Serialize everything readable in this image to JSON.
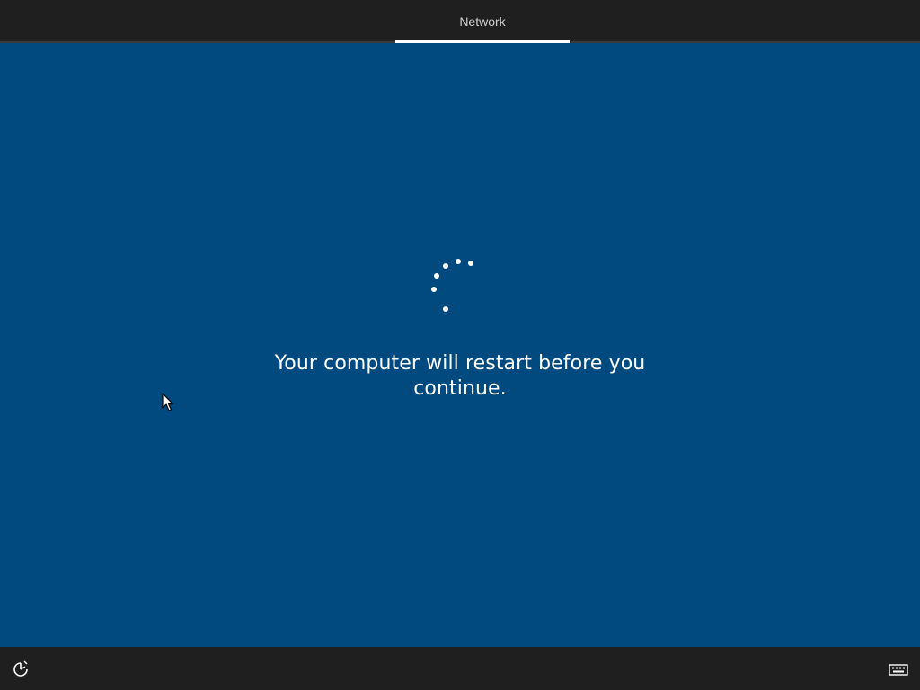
{
  "header": {
    "active_tab_label": "Network"
  },
  "main": {
    "message": "Your computer will restart before you continue."
  },
  "colors": {
    "background": "#004a7f",
    "bars": "#1f1f1f",
    "accent": "#ffffff"
  },
  "icons": {
    "spinner": "loading-dots",
    "ease_of_access": "ease-of-access-icon",
    "keyboard": "keyboard-icon",
    "cursor": "mouse-pointer"
  }
}
